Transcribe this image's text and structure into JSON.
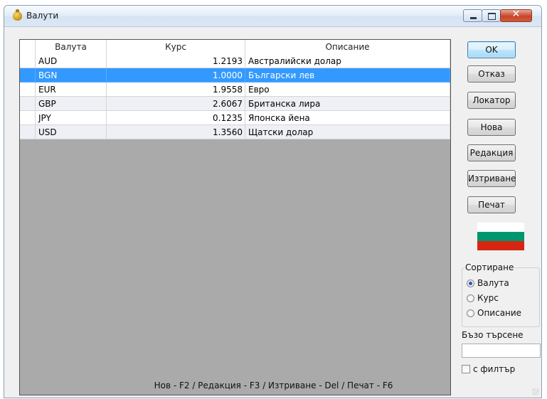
{
  "window": {
    "title": "Валути",
    "icon": "money-bag-icon",
    "close_glyph": "✕"
  },
  "table": {
    "columns": [
      "Валута",
      "Курс",
      "Описание"
    ],
    "rows": [
      {
        "code": "AUD",
        "rate": "1.2193",
        "description": "Австралийски долар"
      },
      {
        "code": "BGN",
        "rate": "1.0000",
        "description": "Български лев"
      },
      {
        "code": "EUR",
        "rate": "1.9558",
        "description": "Евро"
      },
      {
        "code": "GBP",
        "rate": "2.6067",
        "description": "Британска лира"
      },
      {
        "code": "JPY",
        "rate": "0.1235",
        "description": "Японска йена"
      },
      {
        "code": "USD",
        "rate": "1.3560",
        "description": "Щатски долар"
      }
    ],
    "selected_index": 1
  },
  "buttons": {
    "ok": "OK",
    "cancel": "Отказ",
    "locator": "Локатор",
    "new": "Нова",
    "edit": "Редакция",
    "delete": "Изтриване",
    "print": "Печат"
  },
  "flag": {
    "icon": "bulgarian-flag",
    "colors": [
      "#ffffff",
      "#00966e",
      "#d62612"
    ]
  },
  "sort": {
    "legend": "Сортиране",
    "options": [
      "Валута",
      "Курс",
      "Описание"
    ],
    "selected_index": 0
  },
  "quick_search": {
    "label": "Бъзо търсене",
    "value": ""
  },
  "filter": {
    "label": "с филтър",
    "checked": false
  },
  "status_hint": "Нов - F2 / Редакция - F3 / Изтриване - Del / Печат - F6",
  "colors": {
    "selection": "#3399ff",
    "grid_background": "#aaaaaa"
  }
}
